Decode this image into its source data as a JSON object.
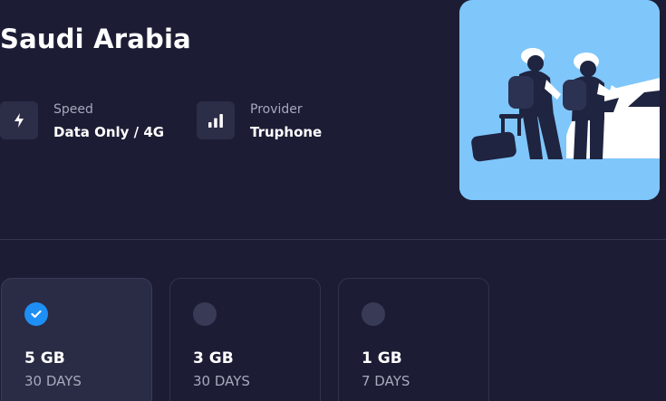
{
  "header": {
    "title": "Saudi Arabia"
  },
  "info": {
    "speed": {
      "label": "Speed",
      "value": "Data Only / 4G",
      "icon": "lightning-icon"
    },
    "provider": {
      "label": "Provider",
      "value": "Truphone",
      "icon": "signal-bars-icon"
    }
  },
  "hero": {
    "icon": "travelers-illustration",
    "background": "#7fc6fb"
  },
  "plans": [
    {
      "size": "5 GB",
      "days": "30 DAYS",
      "selected": true
    },
    {
      "size": "3 GB",
      "days": "30 DAYS",
      "selected": false
    },
    {
      "size": "1 GB",
      "days": "7 DAYS",
      "selected": false
    }
  ],
  "colors": {
    "background": "#1c1d35",
    "card": "#2a2c45",
    "accent": "#1d8ff5",
    "muted_text": "#a7a9bd"
  }
}
